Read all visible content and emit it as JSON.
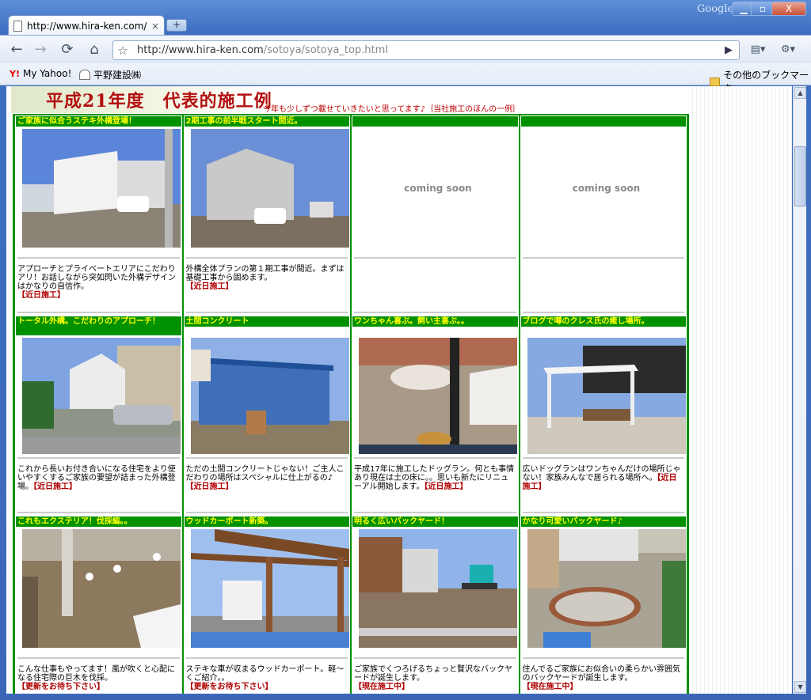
{
  "browser": {
    "tab_title": "http://www.hira-ken.com/...",
    "tab_close": "×",
    "new_tab": "+",
    "brand": "Google",
    "url_host": "http://www.hira-ken.com",
    "url_path": "/sotoya/sotoya_top.html",
    "min": "▁",
    "max": "▫",
    "close": "X",
    "back": "←",
    "forward": "→",
    "reload": "⟳",
    "home": "⌂",
    "star": "☆",
    "go": "▶",
    "page_menu": "▤▾",
    "tools_menu": "⚙▾",
    "bookmarks": [
      "My Yahoo!",
      "平野建設㈱"
    ],
    "other_bookmarks": "その他のブックマーク"
  },
  "page": {
    "title": "平成21年度　代表的施工例",
    "subtitle": "今年も少しずつ載せていきたいと思ってます♪｛当社施工のほんの一例｝",
    "cells": [
      {
        "title": "ご家族に似合うステキ外構登場！",
        "desc": "アプローチとプライベートエリアにこだわりアリ！お話しながら突如閃いた外構デザインはかなりの自信作。",
        "tag": "【近日施工】",
        "image": "white-modern-house"
      },
      {
        "title": "2期工事の前半戦スタート間近。",
        "desc": "外構全体プランの第１期工事が間近。まずは基礎工事から固めます。",
        "tag": "【近日施工】",
        "image": "grey-house-bare-lot"
      },
      {
        "title": "",
        "coming": "coming soon"
      },
      {
        "title": "",
        "coming": "coming soon"
      },
      {
        "title": "トータル外構。こだわりのアプローチ！",
        "desc": "これから長いお付き合いになる住宅をより使いやすくするご家族の要望が詰まった外構登場。",
        "tag": "【近日施工】",
        "image": "house-with-silver-car"
      },
      {
        "title": "土間コンクリート",
        "desc": "ただの土間コンクリートじゃない！ご主人こだわりの場所はスペシャルに仕上がるの♪",
        "tag": "【近日施工】",
        "image": "blue-tarp-garage"
      },
      {
        "title": "ワンちゃん喜ぶ。飼い主喜ぶ。。",
        "desc": "平成17年に施工したドッグラン。何とも事情あり現在は土の床に。。思いも新たにリニューアル開始します。",
        "tag": "【近日施工】",
        "image": "dog-run-yard"
      },
      {
        "title": "ブログで噂のクレス氏の癒し場所。",
        "desc": "広いドッグランはワンちゃんだけの場所じゃない！家族みんなで居られる場所へ。",
        "tag": "【近日施工】",
        "image": "white-pergola"
      },
      {
        "title": "これもエクステリア！伐採編。。",
        "desc": "こんな仕事もやってます！風が吹くと心配になる住宅際の巨木を伐採。",
        "tag": "【更新をお待ち下さい】",
        "image": "tree-cutting-workers"
      },
      {
        "title": "ウッドカーポート新築。",
        "desc": "ステキな車が収まるウッドカーポート。軽〜くご紹介。。",
        "tag": "【更新をお待ち下さい】",
        "image": "wood-carport-construction"
      },
      {
        "title": "明るく広いバックヤード！",
        "desc": "ご家族でくつろげるちょっと贅沢なバックヤードが誕生します。",
        "tag": "【現在施工中】",
        "image": "backyard-excavator"
      },
      {
        "title": "かなり可愛いバックヤード♪",
        "desc": "住んでるご家族にお似合いの柔らかい雰囲気のバックヤードが誕生します。",
        "tag": "【現在施工中】",
        "image": "circular-patio"
      }
    ]
  }
}
